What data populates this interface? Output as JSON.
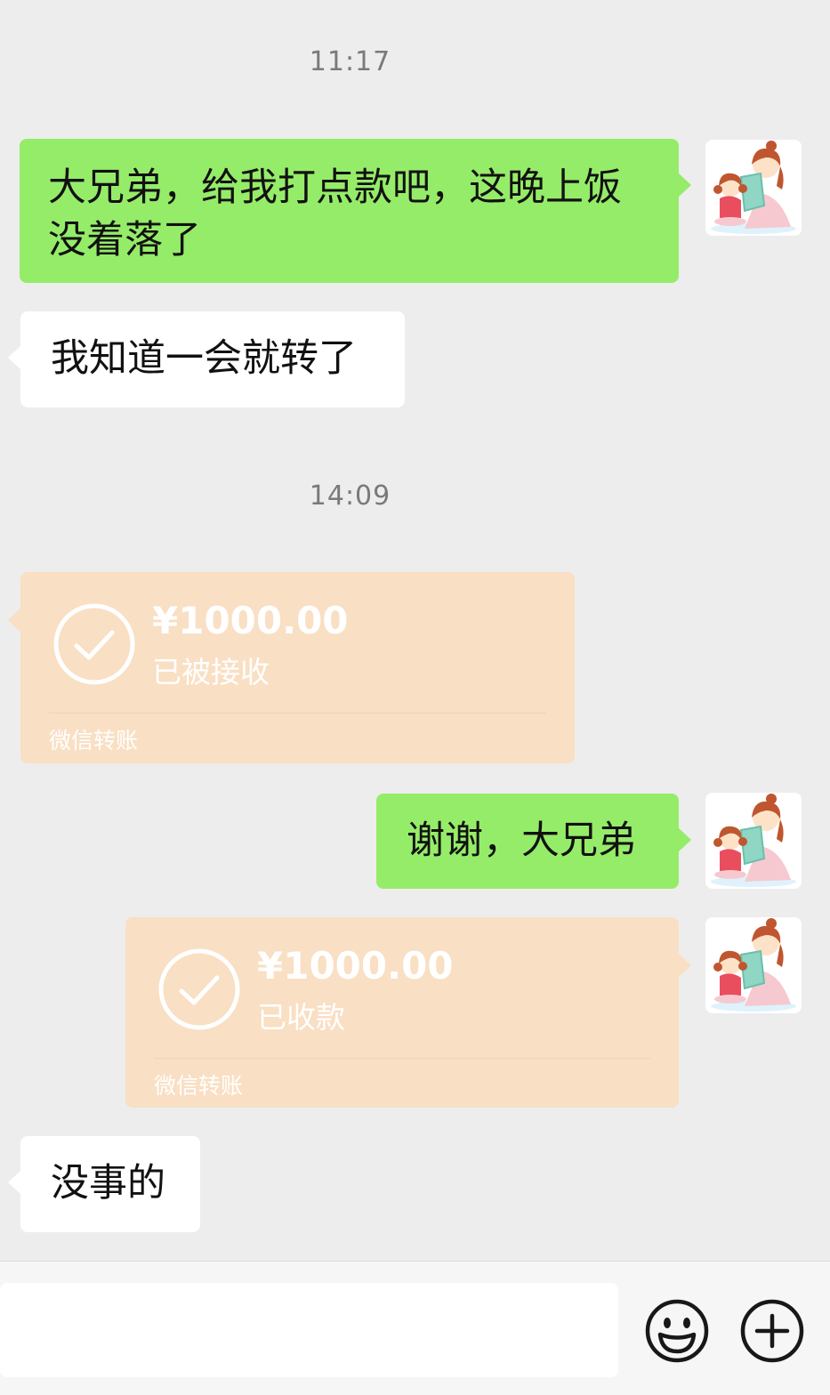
{
  "chat": {
    "time_1": "11:17",
    "time_2": "14:09",
    "messages": {
      "m1": "大兄弟，给我打点款吧，这晚上饭没着落了",
      "m2": "我知道一会就转了",
      "m3": "谢谢，大兄弟",
      "m4": "没事的"
    },
    "transfer_1": {
      "amount": "¥1000.00",
      "status": "已被接收",
      "label": "微信转账"
    },
    "transfer_2": {
      "amount": "¥1000.00",
      "status": "已收款",
      "label": "微信转账"
    }
  },
  "input_bar": {
    "icons": [
      "emoji-icon",
      "plus-icon"
    ]
  },
  "colors": {
    "background": "#ededed",
    "sent_bubble": "#95ec69",
    "received_bubble": "#ffffff",
    "transfer_card": "#f9dfc3"
  }
}
